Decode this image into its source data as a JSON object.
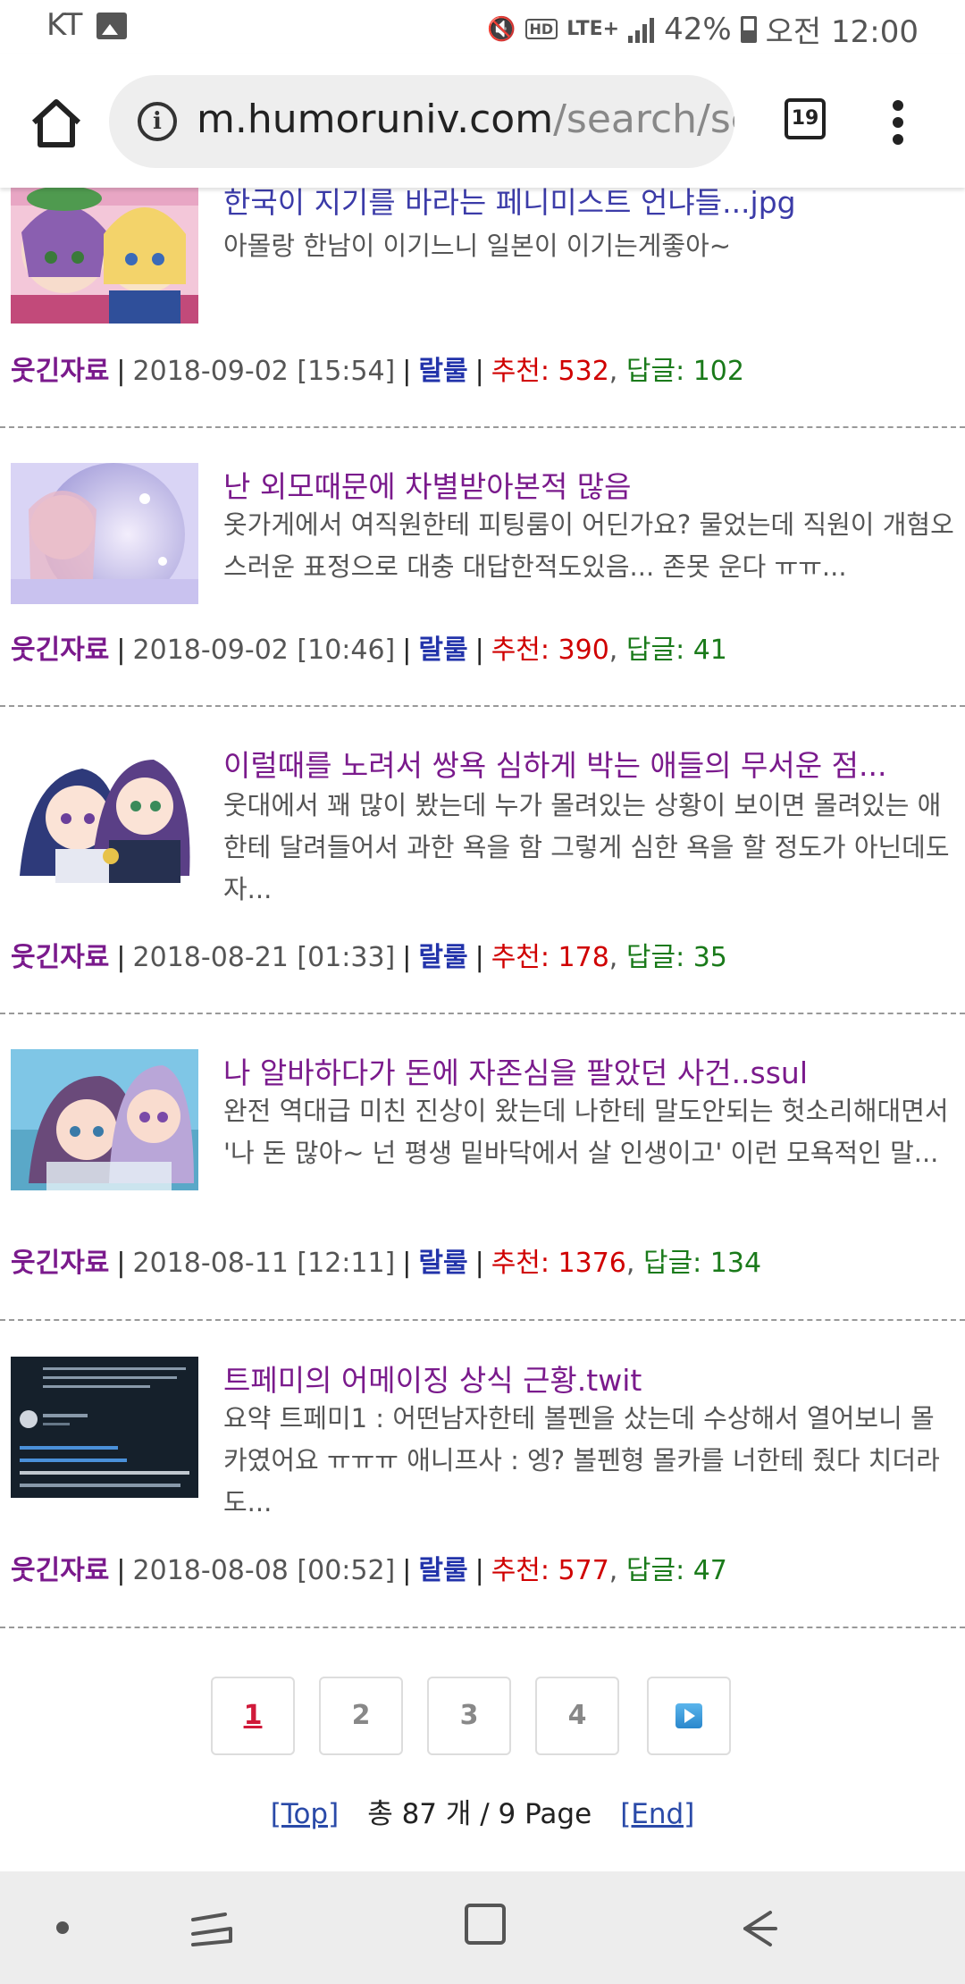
{
  "status_bar": {
    "carrier": "KT",
    "battery": "42%",
    "time": "오전 12:00",
    "network": "LTE+",
    "icons": [
      "image-icon",
      "mute-icon",
      "hd-icon",
      "signal-icon",
      "battery-icon"
    ]
  },
  "browser": {
    "url_host": "m.humoruniv.com",
    "url_path": "/search/se",
    "tab_count": "19"
  },
  "posts": [
    {
      "title": "한국이 지기를 바라는 페니미스트 언냐들...jpg",
      "summary": "아몰랑 한남이 이기느니 일본이 이기는게좋아~",
      "category": "웃긴자료",
      "date": "2018-09-02 [15:54]",
      "author": "랄룰",
      "rec_label": "추천: 532",
      "rep_label": "답글: 102"
    },
    {
      "title": "난 외모때문에 차별받아본적 많음",
      "summary": "옷가게에서 여직원한테 피팅룸이 어딘가요? 물었는데 직원이 개혐오스러운 표정으로 대충 대답한적도있음... 존못 운다 ㅠㅠ...",
      "category": "웃긴자료",
      "date": "2018-09-02 [10:46]",
      "author": "랄룰",
      "rec_label": "추천: 390",
      "rep_label": "답글: 41"
    },
    {
      "title": "이럴때를 노려서 쌍욕 심하게 박는 애들의 무서운 점...",
      "summary": "웃대에서 꽤 많이 봤는데 누가 몰려있는 상황이 보이면 몰려있는 애한테 달려들어서 과한 욕을 함 그렇게 심한 욕을 할 정도가 아닌데도 자...",
      "category": "웃긴자료",
      "date": "2018-08-21 [01:33]",
      "author": "랄룰",
      "rec_label": "추천: 178",
      "rep_label": "답글: 35"
    },
    {
      "title": "나 알바하다가 돈에 자존심을 팔았던 사건..ssul",
      "summary": "완전 역대급 미친 진상이 왔는데 나한테 말도안되는 헛소리해대면서 '나 돈 많아~ 넌 평생 밑바닥에서 살 인생이고' 이런 모욕적인 말...",
      "category": "웃긴자료",
      "date": "2018-08-11 [12:11]",
      "author": "랄룰",
      "rec_label": "추천: 1376",
      "rep_label": "답글: 134"
    },
    {
      "title": "트페미의 어메이징 상식 근황.twit",
      "summary": "요약 트페미1 : 어떤남자한테 볼펜을 샀는데 수상해서 열어보니 몰카였어요 ㅠㅠㅠ 애니프사 : 엥? 볼펜형 몰카를 너한테 줬다 치더라도...",
      "category": "웃긴자료",
      "date": "2018-08-08 [00:52]",
      "author": "랄룰",
      "rec_label": "추천: 577",
      "rep_label": "답글: 47"
    }
  ],
  "pagination": {
    "pages": [
      "1",
      "2",
      "3",
      "4"
    ],
    "current": "1"
  },
  "footer": {
    "top_link": "[Top]",
    "total": "총 87 개 / 9 Page",
    "end_link": "[End]"
  },
  "colors": {
    "title_purple": "#7a1a8c",
    "author_blue": "#2233aa",
    "recommend_red": "#d00000",
    "reply_green": "#1a7a1a"
  }
}
